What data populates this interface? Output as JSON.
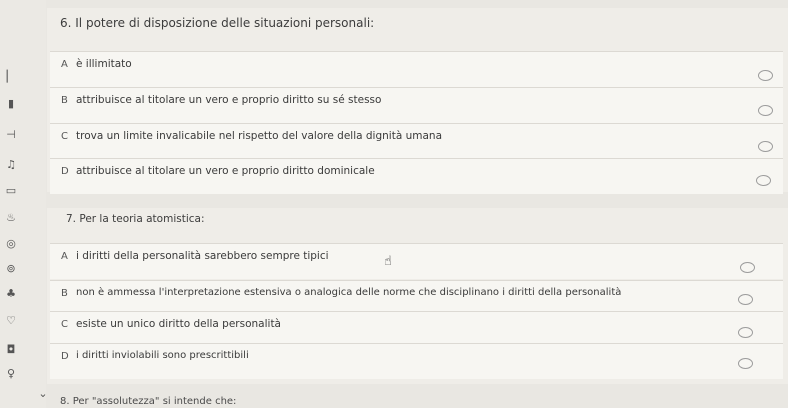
{
  "rail": {
    "icons": [
      "bookmark-icon",
      "flag-icon",
      "steps-icon",
      "note-icon",
      "chart-icon",
      "timer-icon",
      "settings-icon",
      "users-icon",
      "comment-icon",
      "document-icon",
      "person-icon",
      "chevron-down-icon"
    ]
  },
  "q6": {
    "title": "6. Il potere di disposizione delle situazioni personali:",
    "options": [
      {
        "letter": "A",
        "text": "è illimitato"
      },
      {
        "letter": "B",
        "text": "attribuisce al titolare un vero e proprio diritto su sé stesso"
      },
      {
        "letter": "C",
        "text": "trova un limite invalicabile nel rispetto del valore della dignità umana"
      },
      {
        "letter": "D",
        "text": "attribuisce al titolare un vero e proprio diritto dominicale"
      }
    ]
  },
  "q7": {
    "title": "7. Per la teoria atomistica:",
    "options": [
      {
        "letter": "A",
        "text": "i diritti della personalità sarebbero sempre tipici"
      },
      {
        "letter": "B",
        "text": "non è ammessa l'interpretazione estensiva o analogica delle norme che disciplinano i diritti della personalità"
      },
      {
        "letter": "C",
        "text": "esiste un unico diritto della personalità"
      },
      {
        "letter": "D",
        "text": "i diritti inviolabili sono prescrittibili"
      }
    ]
  },
  "q8": {
    "title": "8. Per \"assolutezza\" si intende che:"
  }
}
